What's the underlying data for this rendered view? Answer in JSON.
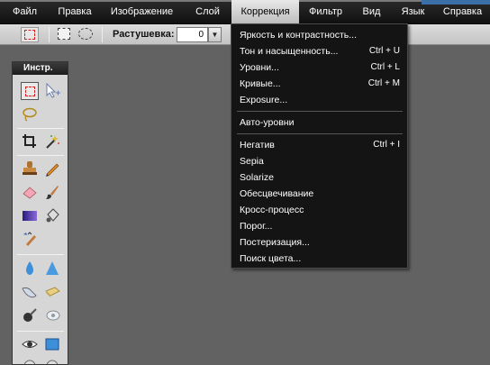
{
  "menubar": {
    "items": [
      "Файл",
      "Правка",
      "Изображение",
      "Слой",
      "Коррекция",
      "Фильтр",
      "Вид",
      "Язык",
      "Справка"
    ],
    "active": "Коррекция"
  },
  "options_bar": {
    "feather_label": "Растушевка:",
    "feather_value": "0"
  },
  "tool_panel": {
    "title": "Инстр."
  },
  "adjustment_menu": {
    "items": [
      {
        "label": "Яркость и контрастность...",
        "shortcut": ""
      },
      {
        "label": "Тон и насыщенность...",
        "shortcut": "Ctrl + U"
      },
      {
        "label": "Уровни...",
        "shortcut": "Ctrl + L"
      },
      {
        "label": "Кривые...",
        "shortcut": "Ctrl + M"
      },
      {
        "label": "Exposure...",
        "shortcut": ""
      },
      {
        "label": "Авто-уровни",
        "shortcut": ""
      },
      {
        "label": "Негатив",
        "shortcut": "Ctrl + I"
      },
      {
        "label": "Sepia",
        "shortcut": ""
      },
      {
        "label": "Solarize",
        "shortcut": ""
      },
      {
        "label": "Обесцвечивание",
        "shortcut": ""
      },
      {
        "label": "Кросс-процесс",
        "shortcut": ""
      },
      {
        "label": "Порог...",
        "shortcut": ""
      },
      {
        "label": "Постеризация...",
        "shortcut": ""
      },
      {
        "label": "Поиск цвета...",
        "shortcut": ""
      }
    ]
  },
  "colors": {
    "workspace": "#626262",
    "menubar": "#141414",
    "menu_bg": "#141414",
    "selection_red": "#d12020"
  }
}
